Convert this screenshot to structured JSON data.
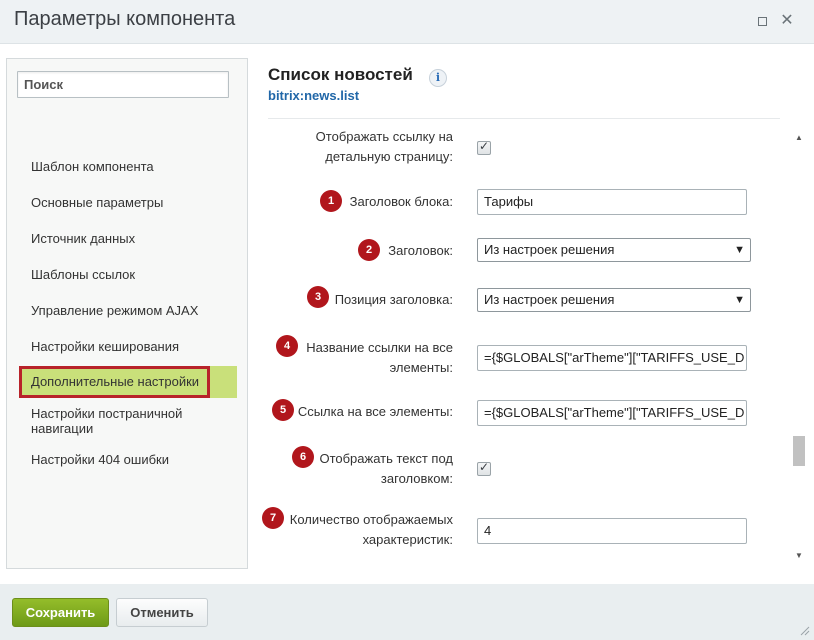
{
  "window": {
    "title": "Параметры компонента"
  },
  "sidebar": {
    "search_placeholder": "Поиск",
    "items": [
      {
        "label": "Шаблон компонента"
      },
      {
        "label": "Основные параметры"
      },
      {
        "label": "Источник данных"
      },
      {
        "label": "Шаблоны ссылок"
      },
      {
        "label": "Управление режимом AJAX"
      },
      {
        "label": "Настройки кеширования"
      },
      {
        "label": "Дополнительные настройки",
        "active": true
      },
      {
        "label": "Настройки постраничной навигации"
      },
      {
        "label": "Настройки 404 ошибки"
      }
    ]
  },
  "main": {
    "title": "Список новостей",
    "component_code": "bitrix:news.list",
    "fields": {
      "detail_link": {
        "label_1": "Отображать ссылку на",
        "label_2": "детальную страницу:",
        "checked": true
      },
      "block_title": {
        "badge": "1",
        "label": "Заголовок блока:",
        "value": "Тарифы"
      },
      "heading": {
        "badge": "2",
        "label": "Заголовок:",
        "value": "Из настроек решения"
      },
      "heading_position": {
        "badge": "3",
        "label": "Позиция заголовка:",
        "value": "Из настроек решения"
      },
      "all_link_name": {
        "badge": "4",
        "label_1": "Название ссылки на все",
        "label_2": "элементы:",
        "value": "={$GLOBALS[\"arTheme\"][\"TARIFFS_USE_D"
      },
      "all_link": {
        "badge": "5",
        "label": "Ссылка на все элементы:",
        "value": "={$GLOBALS[\"arTheme\"][\"TARIFFS_USE_D"
      },
      "show_text": {
        "badge": "6",
        "label_1": "Отображать текст под",
        "label_2": "заголовком:",
        "checked": true
      },
      "props_count": {
        "badge": "7",
        "label_1": "Количество отображаемых",
        "label_2": "характеристик:",
        "value": "4"
      }
    }
  },
  "footer": {
    "save_label": "Сохранить",
    "cancel_label": "Отменить"
  },
  "colors": {
    "badge": "#b1161c",
    "active_item_bg": "#c9e07a",
    "active_item_border": "#b8232a",
    "save_button": "#7ea620",
    "component_code": "#2167a8"
  }
}
